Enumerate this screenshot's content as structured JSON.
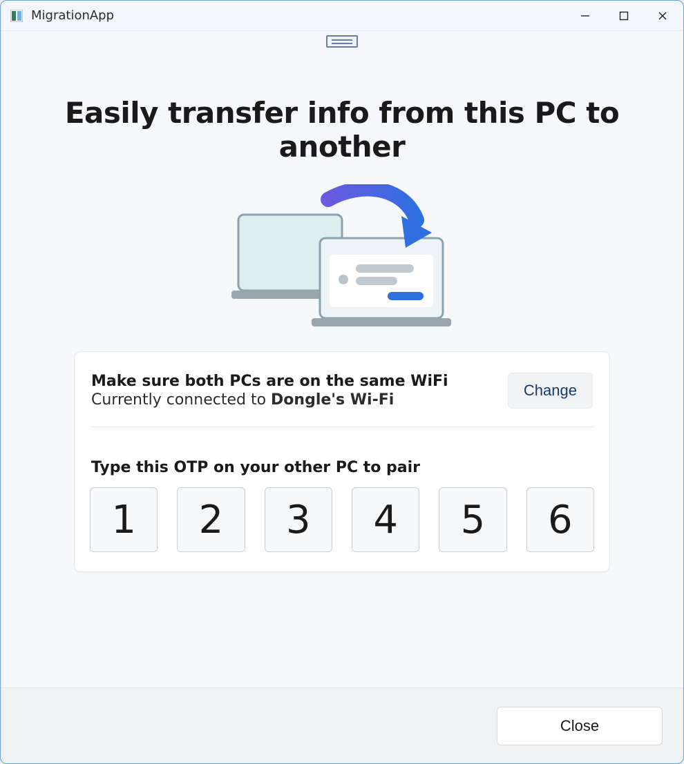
{
  "window": {
    "title": "MigrationApp"
  },
  "main": {
    "heading": "Easily transfer info from this PC to another"
  },
  "wifi": {
    "instruction": "Make sure both PCs are on the same WiFi",
    "connected_prefix": "Currently connected to ",
    "network_name": "Dongle's Wi-Fi",
    "change_label": "Change"
  },
  "otp": {
    "instruction": "Type this OTP on your other PC to pair",
    "digits": [
      "1",
      "2",
      "3",
      "4",
      "5",
      "6"
    ]
  },
  "footer": {
    "close_label": "Close"
  }
}
